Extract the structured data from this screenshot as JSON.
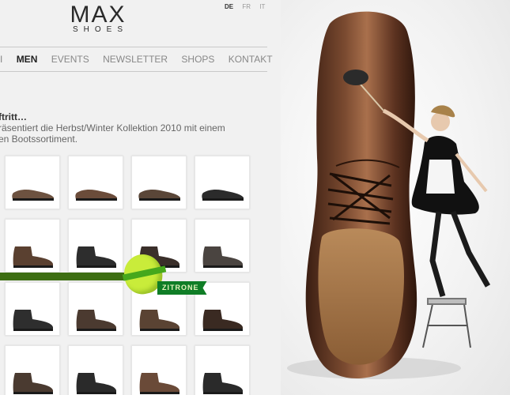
{
  "header": {
    "logo_main": "MAX",
    "logo_sub": "SHOES",
    "languages": [
      "DE",
      "FR",
      "IT"
    ]
  },
  "nav": {
    "items": [
      "I",
      "MEN",
      "EVENTS",
      "NEWSLETTER",
      "SHOPS",
      "KONTAKT"
    ],
    "current": "MEN"
  },
  "intro": {
    "title": "ftritt…",
    "text_line1": "räsentiert die Herbst/Winter Kollektion 2010 mit einem",
    "text_line2": "en Bootssortiment."
  },
  "badge": {
    "label": "ZITRONE"
  },
  "colors": {
    "shoe_brown": "#6d4431",
    "shoe_dark": "#2a2a2a",
    "badge_green": "#0f7d26",
    "bar_green": "#3d6e12",
    "lemon": "#c9ec3a"
  }
}
